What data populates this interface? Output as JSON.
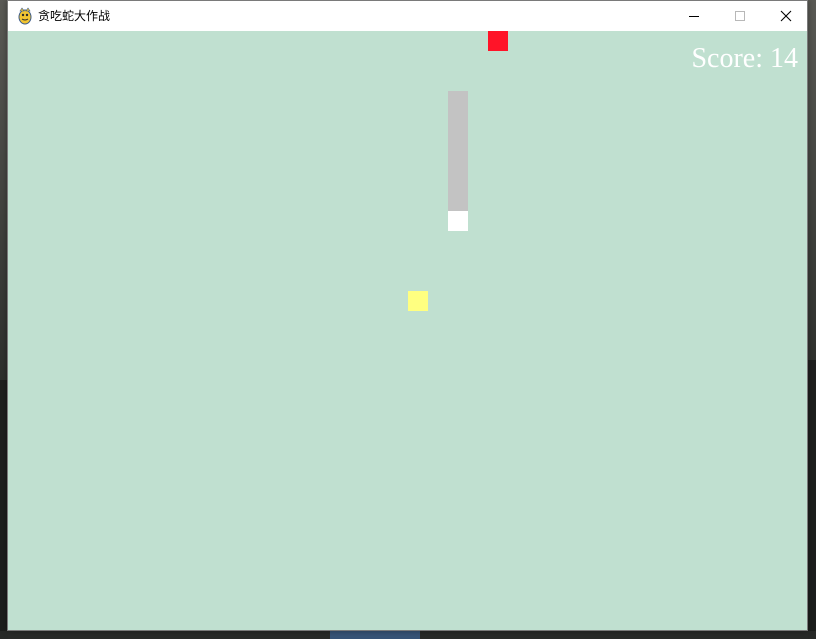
{
  "window": {
    "title": "贪吃蛇大作战",
    "app_icon": "pygame-snake-icon",
    "controls": {
      "minimize_icon": "minimize-icon",
      "maximize_icon": "maximize-icon",
      "close_icon": "close-icon"
    }
  },
  "game": {
    "background_color": "#c0e0d0",
    "score_label": "Score:",
    "score_value": "14",
    "score_color": "#ffffff",
    "snake": {
      "body_color": "#c3c3c3",
      "head_color": "#ffffff",
      "segment_count": 7
    },
    "food": {
      "color": "#ffff80"
    },
    "bomb": {
      "color": "#ff1428"
    }
  }
}
